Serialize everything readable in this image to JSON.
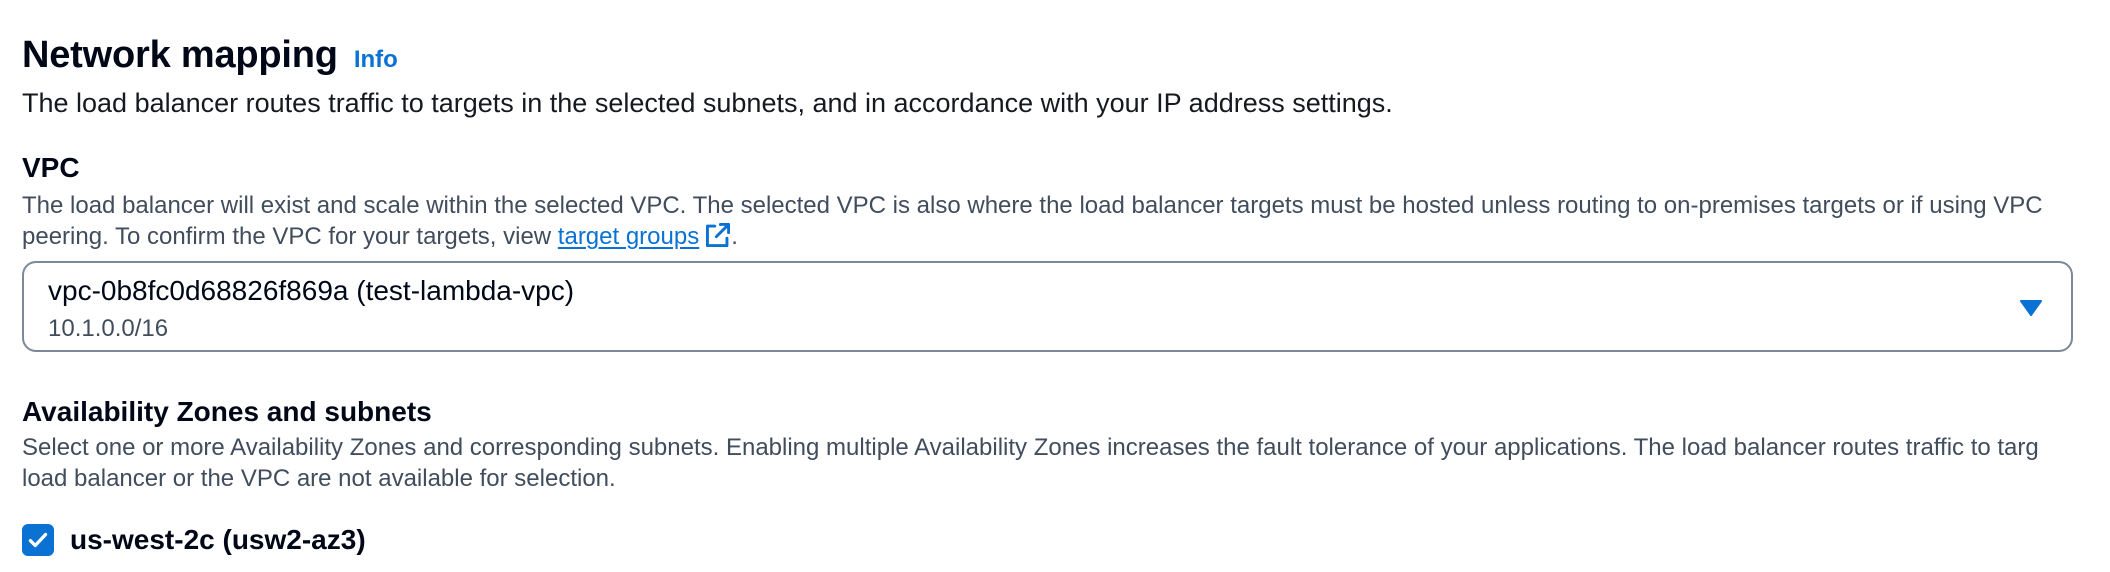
{
  "network_mapping": {
    "title": "Network mapping",
    "info_label": "Info",
    "description": "The load balancer routes traffic to targets in the selected subnets, and in accordance with your IP address settings."
  },
  "vpc": {
    "label": "VPC",
    "description_part1": "The load balancer will exist and scale within the selected VPC. The selected VPC is also where the load balancer targets must be hosted unless routing to on-premises targets or if using VPC",
    "description_part2_prefix": "peering. To confirm the VPC for your targets, view ",
    "link_text": "target groups",
    "description_part2_suffix": ".",
    "selected_value": "vpc-0b8fc0d68826f869a (test-lambda-vpc)",
    "selected_cidr": "10.1.0.0/16"
  },
  "availability_zones": {
    "label": "Availability Zones and subnets",
    "description_line1": "Select one or more Availability Zones and corresponding subnets. Enabling multiple Availability Zones increases the fault tolerance of your applications. The load balancer routes traffic to targ",
    "description_line2": "load balancer or the VPC are not available for selection.",
    "zones": [
      {
        "label": "us-west-2c (usw2-az3)",
        "checked": true
      }
    ]
  },
  "colors": {
    "link": "#0972d3",
    "text": "#000716",
    "secondary_text": "#414d5c",
    "border": "#7d8998"
  },
  "icons": {
    "external_link": "external-link-icon",
    "dropdown": "caret-down-icon",
    "checkbox": "checkmark-icon"
  }
}
